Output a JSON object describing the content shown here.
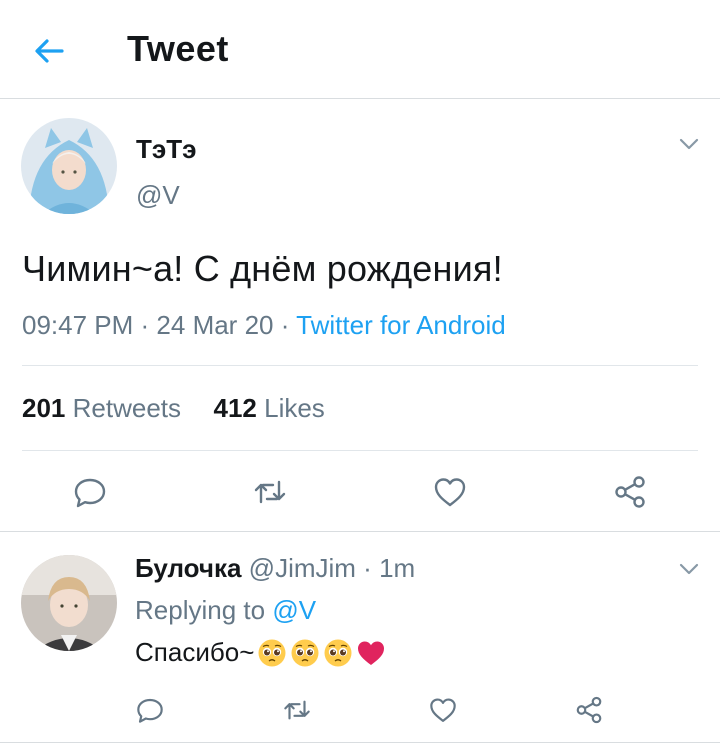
{
  "header": {
    "title": "Tweet",
    "back_icon": "arrow-left-icon",
    "accent": "#1da1f2"
  },
  "tweet": {
    "display_name": "ТэТэ",
    "handle": "@V",
    "text": "Чимин~а! С днём рождения!",
    "time": "09:47 PM",
    "date": "24 Mar 20",
    "source": "Twitter for Android",
    "retweets": "201",
    "retweets_label": "Retweets",
    "likes": "412",
    "likes_label": "Likes"
  },
  "reply": {
    "display_name": "Булочка",
    "handle": "@JimJim",
    "time": "1m",
    "replying_to_label": "Replying to",
    "replying_to": "@V",
    "text": "Спасибо~",
    "emojis": [
      "pleading-face-icon",
      "pleading-face-icon",
      "pleading-face-icon",
      "red-heart-icon"
    ]
  },
  "colors": {
    "text": "#14171a",
    "secondary": "#657786",
    "link": "#1da1f2",
    "divider": "#d9dde0"
  }
}
